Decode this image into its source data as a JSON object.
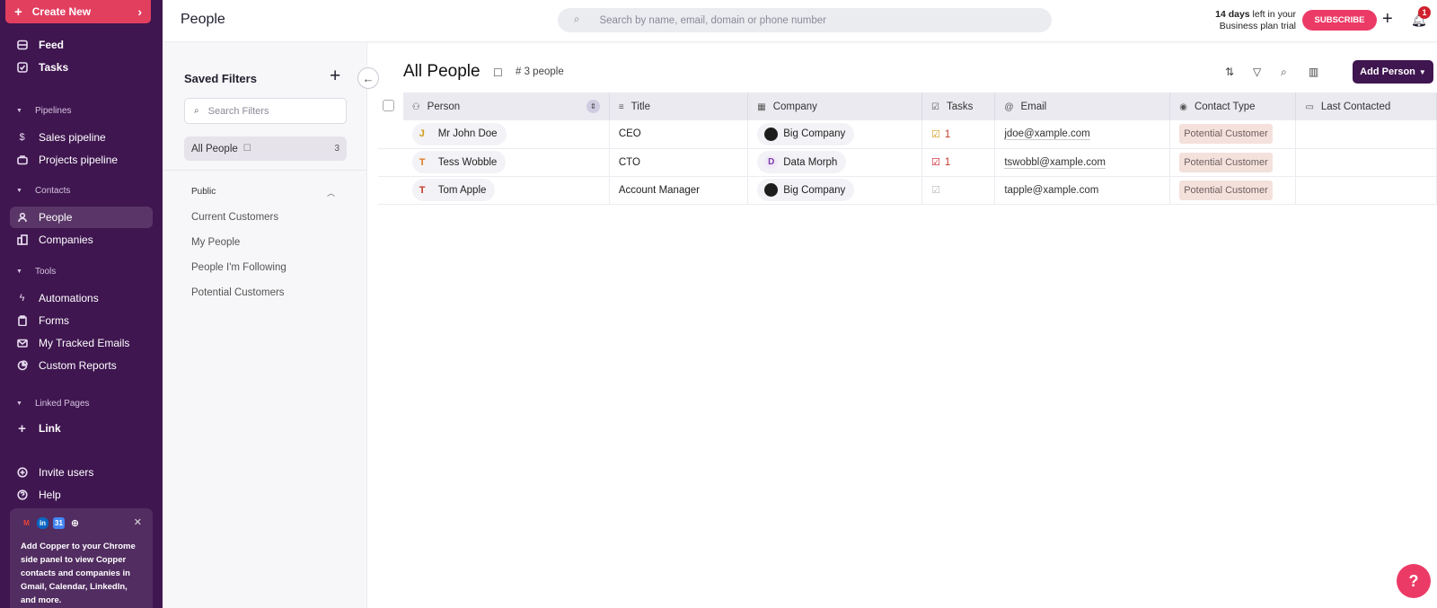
{
  "sidebar": {
    "create_label": "Create New",
    "feed": "Feed",
    "tasks": "Tasks",
    "pipelines_head": "Pipelines",
    "sales_pipeline": "Sales pipeline",
    "projects_pipeline": "Projects pipeline",
    "contacts_head": "Contacts",
    "people": "People",
    "companies": "Companies",
    "tools_head": "Tools",
    "automations": "Automations",
    "forms": "Forms",
    "tracked_emails": "My Tracked Emails",
    "custom_reports": "Custom Reports",
    "linked_head": "Linked Pages",
    "link": "Link",
    "invite": "Invite users",
    "help": "Help",
    "promo_text": "Add Copper to your Chrome side panel to view Copper contacts and companies in Gmail, Calendar, LinkedIn, and more."
  },
  "topbar": {
    "title": "People",
    "search_placeholder": "Search by name, email, domain or phone number",
    "trial_days": "14 days",
    "trial_rest1": " left in your",
    "trial_rest2": "Business plan trial",
    "subscribe": "SUBSCRIBE",
    "notif_count": "1"
  },
  "filters": {
    "title": "Saved Filters",
    "search_placeholder": "Search Filters",
    "all_people": "All People",
    "all_people_count": "3",
    "public_head": "Public",
    "items": [
      "Current Customers",
      "My People",
      "People I'm Following",
      "Potential Customers"
    ]
  },
  "main": {
    "title": "All People",
    "count": "3 people",
    "add_person": "Add Person",
    "columns": {
      "person": "Person",
      "title": "Title",
      "company": "Company",
      "tasks": "Tasks",
      "email": "Email",
      "contact_type": "Contact Type",
      "last_contacted": "Last Contacted"
    },
    "rows": [
      {
        "initial": "J",
        "name": "Mr John Doe",
        "title": "CEO",
        "company": "Big Company",
        "company_initial": "",
        "tasks": "1",
        "email": "jdoe@xample.com",
        "contact_type": "Potential Customer"
      },
      {
        "initial": "T",
        "name": "Tess Wobble",
        "title": "CTO",
        "company": "Data Morph",
        "company_initial": "D",
        "tasks": "1",
        "email": "tswobbl@xample.com",
        "contact_type": "Potential Customer"
      },
      {
        "initial": "T",
        "name": "Tom Apple",
        "title": "Account Manager",
        "company": "Big Company",
        "company_initial": "",
        "tasks": "",
        "email": "tapple@xample.com",
        "contact_type": "Potential Customer"
      }
    ]
  },
  "colors": {
    "sidebar_bg": "#3f1650",
    "accent": "#ec3a66",
    "create_bg": "#e23f5f"
  }
}
